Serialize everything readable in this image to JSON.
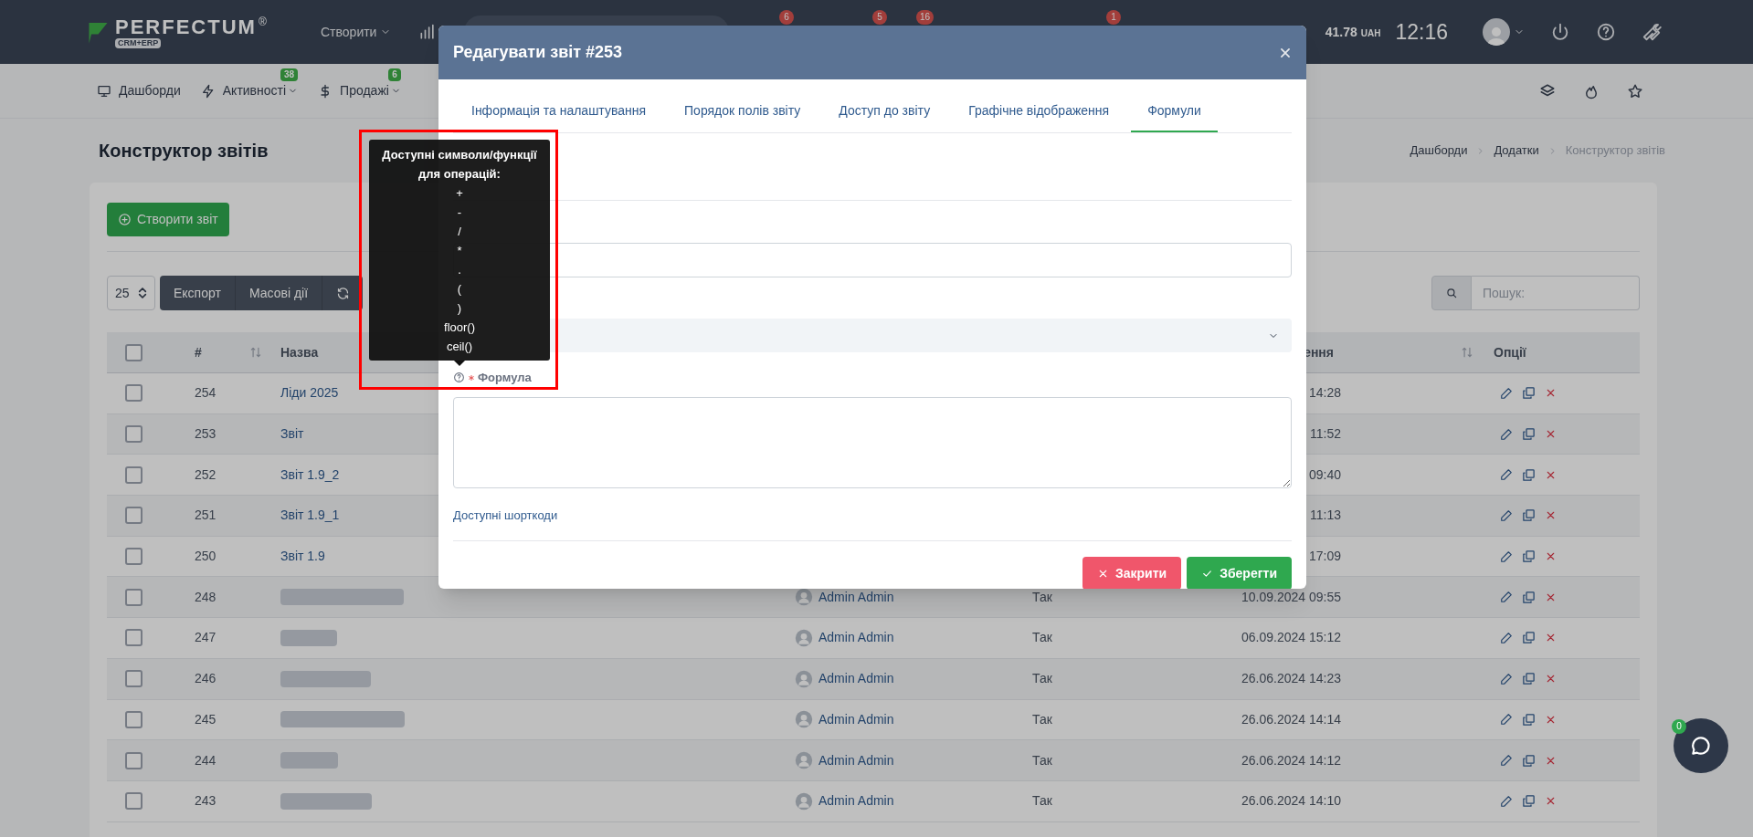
{
  "topbar": {
    "logo": {
      "name": "PERFECTUM",
      "mark": "®",
      "sub": "CRM+ERP"
    },
    "create_menu": "Створити",
    "badges": [
      "6",
      "5",
      "16",
      "1"
    ],
    "balance": {
      "amount": "41.78",
      "currency": "UAH"
    },
    "time": "12:16"
  },
  "nav": {
    "items": [
      {
        "label": "Дашборди",
        "dropdown": false
      },
      {
        "label": "Активності",
        "badge": "38",
        "dropdown": true
      },
      {
        "label": "Продажі",
        "badge": "6",
        "dropdown": true
      }
    ]
  },
  "page": {
    "title": "Конструктор звітів",
    "breadcrumbs": [
      "Дашборди",
      "Додатки",
      "Конструктор звітів"
    ]
  },
  "toolbar": {
    "create_button": "Створити звіт",
    "page_size": "25",
    "buttons": [
      "Експорт",
      "Масові дії"
    ],
    "search_placeholder": "Пошук:"
  },
  "table": {
    "all_checked": false,
    "columns": [
      {
        "label": "#",
        "sortable": true
      },
      {
        "label": "Назва",
        "sortable": false
      },
      {
        "label": "ення",
        "sortable": true
      },
      {
        "label": "Опції",
        "sortable": false
      }
    ],
    "rows": [
      {
        "id": "254",
        "name": "Ліди 2025",
        "redacted": false,
        "date": "14:28",
        "checked": false
      },
      {
        "id": "253",
        "name": "Звіт",
        "redacted": false,
        "date": "11:52",
        "checked": false
      },
      {
        "id": "252",
        "name": "Звіт 1.9_2",
        "redacted": false,
        "date": "09:40",
        "checked": false
      },
      {
        "id": "251",
        "name": "Звіт 1.9_1",
        "redacted": false,
        "date": "11:13",
        "checked": false
      },
      {
        "id": "250",
        "name": "Звіт 1.9",
        "redacted": false,
        "date": "17:09",
        "checked": false
      },
      {
        "id": "248",
        "redacted": true,
        "author": "Admin Admin",
        "active": "Так",
        "date": "10.09.2024 09:55",
        "checked": false
      },
      {
        "id": "247",
        "redacted": true,
        "author": "Admin Admin",
        "active": "Так",
        "date": "06.09.2024 15:12",
        "checked": false
      },
      {
        "id": "246",
        "redacted": true,
        "author": "Admin Admin",
        "active": "Так",
        "date": "26.06.2024 14:23",
        "checked": false
      },
      {
        "id": "245",
        "redacted": true,
        "author": "Admin Admin",
        "active": "Так",
        "date": "26.06.2024 14:14",
        "checked": false
      },
      {
        "id": "244",
        "redacted": true,
        "author": "Admin Admin",
        "active": "Так",
        "date": "26.06.2024 14:12",
        "checked": false
      },
      {
        "id": "243",
        "redacted": true,
        "author": "Admin Admin",
        "active": "Так",
        "date": "26.06.2024 14:10",
        "checked": false
      }
    ]
  },
  "modal": {
    "title": "Редагувати звіт #253",
    "tabs": [
      {
        "label": "Інформація та налаштування",
        "selected": false
      },
      {
        "label": "Порядок полів звіту",
        "selected": false
      },
      {
        "label": "Доступ до звіту",
        "selected": false
      },
      {
        "label": "Графічне відображення",
        "selected": false
      },
      {
        "label": "Формули",
        "selected": true
      }
    ],
    "formula_label": {
      "text": "Формула",
      "required": true
    },
    "shortcodes_link": "Доступні шорткоди",
    "buttons": [
      {
        "kind": "danger",
        "label": "Закрити"
      },
      {
        "kind": "success",
        "label": "Зберегти"
      }
    ]
  },
  "tooltip": {
    "title": "Доступні символи/функції для операцій:",
    "items": [
      "+",
      "-",
      "/",
      "*",
      ".",
      "(",
      ")",
      "floor()",
      "ceil()"
    ]
  },
  "highlight_frame": true,
  "chat": {
    "badge": "0"
  }
}
